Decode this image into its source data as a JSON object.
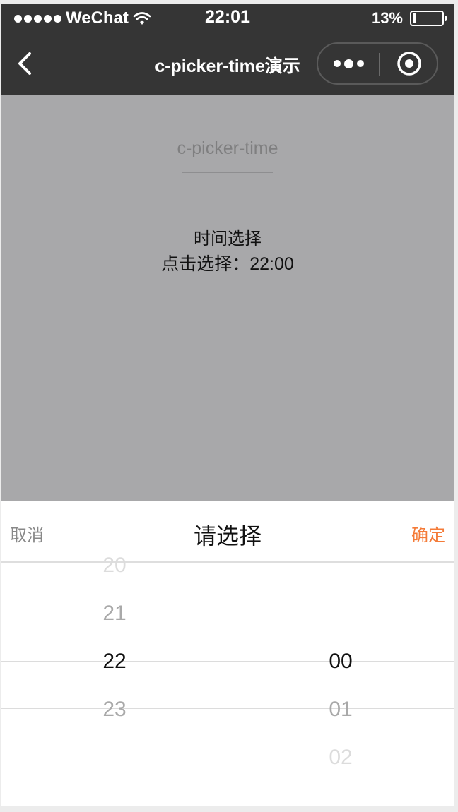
{
  "status_bar": {
    "carrier": "WeChat",
    "time": "22:01",
    "battery": "13%",
    "battery_level": 0.13
  },
  "nav": {
    "title": "c-picker-time演示"
  },
  "page": {
    "title": "c-picker-time",
    "section_label": "时间选择",
    "picked_text": "点击选择：22:00"
  },
  "picker": {
    "cancel": "取消",
    "title": "请选择",
    "confirm": "确定",
    "hours": [
      "20",
      "21",
      "22",
      "23"
    ],
    "selected_hour": "22",
    "minutes": [
      "00",
      "01",
      "02"
    ],
    "selected_minute": "00"
  },
  "colors": {
    "nav_bg": "#353535",
    "page_bg": "#a8a8aa",
    "confirm": "#f47b38"
  }
}
